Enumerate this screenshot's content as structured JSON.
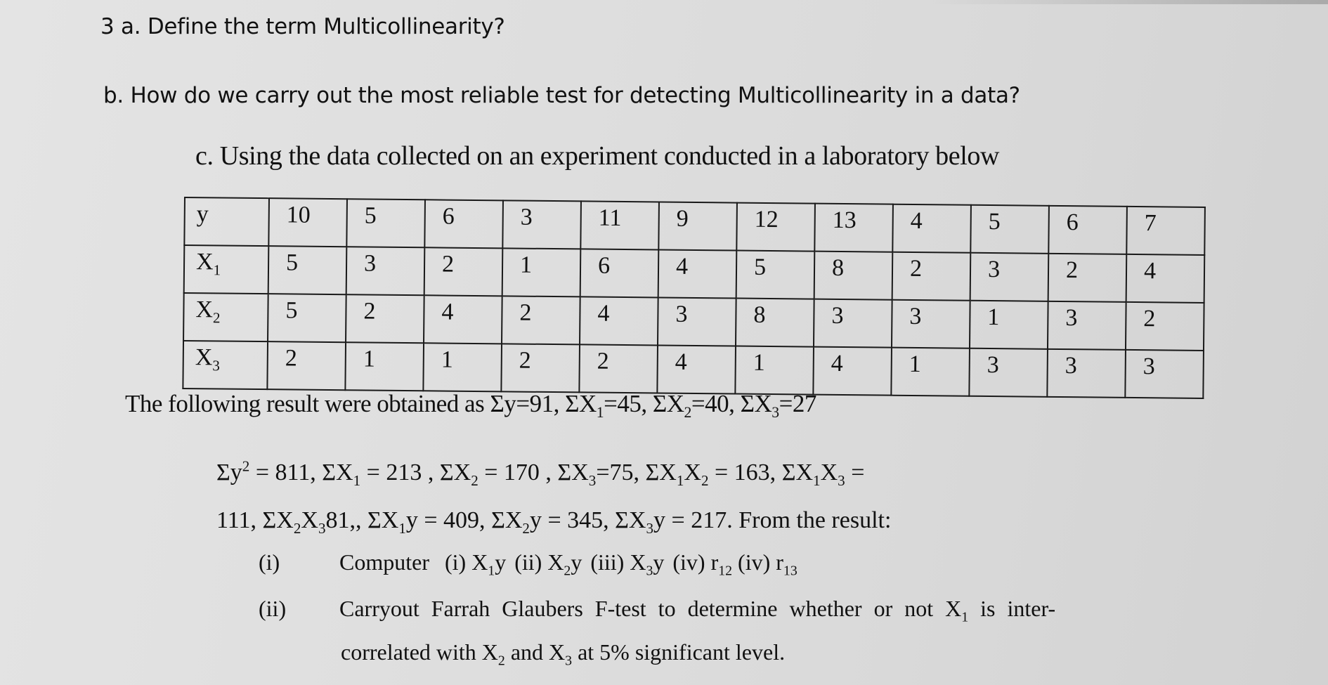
{
  "question_a": {
    "number": "3",
    "label": "a.",
    "text": "Define the term Multicollinearity?"
  },
  "question_b": {
    "label": "b.",
    "text": "How do we carry out the most reliable test for detecting Multicollinearity in a data?"
  },
  "question_c": {
    "label": "c.",
    "text": "Using the data collected on an experiment conducted in a laboratory below"
  },
  "table": {
    "rows": [
      {
        "var": "y",
        "sub": "",
        "values": [
          "10",
          "5",
          "6",
          "3",
          "11",
          "9",
          "12",
          "13",
          "4",
          "5",
          "6",
          "7"
        ]
      },
      {
        "var": "X",
        "sub": "1",
        "values": [
          "5",
          "3",
          "2",
          "1",
          "6",
          "4",
          "5",
          "8",
          "2",
          "3",
          "2",
          "4"
        ]
      },
      {
        "var": "X",
        "sub": "2",
        "values": [
          "5",
          "2",
          "4",
          "2",
          "4",
          "3",
          "8",
          "3",
          "3",
          "1",
          "3",
          "2"
        ]
      },
      {
        "var": "X",
        "sub": "3",
        "values": [
          "2",
          "1",
          "1",
          "2",
          "2",
          "4",
          "1",
          "4",
          "1",
          "3",
          "3",
          "3"
        ]
      }
    ]
  },
  "results": {
    "intro": "The following result were obtained as",
    "sum_y": "Σy=91,",
    "sum_x1_pre": "ΣX",
    "sum_x1_sub": "1",
    "sum_x1_post": "=45,",
    "sum_x2_pre": "ΣX",
    "sum_x2_sub": "2",
    "sum_x2_post": "=40,",
    "sum_x3_pre": "ΣX",
    "sum_x3_sub": "3",
    "sum_x3_post": "=27"
  },
  "equations": {
    "line1": {
      "sy2_pre": "Σy",
      "sy2_sup": "2",
      "sy2_post": " = 811, ",
      "sx1_pre": "ΣX",
      "sx1_sub": "1",
      "sx1_post": " = 213 , ",
      "sx2_pre": "ΣX",
      "sx2_sub": "2",
      "sx2_post": " = 170 , ",
      "sx3_pre": "ΣX",
      "sx3_sub": "3",
      "sx3_post": "=75, ",
      "sx1x2_pre": "ΣX",
      "sx1x2_sub1": "1",
      "sx1x2_mid": "X",
      "sx1x2_sub2": "2",
      "sx1x2_post": " = 163, ",
      "sx1x3_pre": "ΣX",
      "sx1x3_sub1": "1",
      "sx1x3_mid": "X",
      "sx1x3_sub2": "3",
      "sx1x3_post": " ="
    },
    "line2": {
      "v111": "111, ",
      "sx2x3_pre": "ΣX",
      "sx2x3_sub1": "2",
      "sx2x3_mid": "X",
      "sx2x3_sub2": "3",
      "sx2x3_post": "81,, ",
      "sx1y_pre": "ΣX",
      "sx1y_sub": "1",
      "sx1y_post": "y = 409, ",
      "sx2y_pre": "ΣX",
      "sx2y_sub": "2",
      "sx2y_post": "y = 345, ",
      "sx3y_pre": "ΣX",
      "sx3y_sub": "3",
      "sx3y_post": "y = 217.",
      "tail": " From the result:"
    }
  },
  "items": {
    "i": {
      "num": "(i)",
      "lead": "Computer",
      "p1_label": "(i) ",
      "p1_var": "X",
      "p1_sub": "1",
      "p1_post": "y",
      "p2_label": "(ii) ",
      "p2_var": "X",
      "p2_sub": "2",
      "p2_post": "y",
      "p3_label": "(iii) ",
      "p3_var": "X",
      "p3_sub": "3",
      "p3_post": "y",
      "p4_label": "(iv) ",
      "p4_var": "r",
      "p4_sub": "12",
      "p5_label": "(iv) ",
      "p5_var": "r",
      "p5_sub": "13"
    },
    "ii": {
      "num": "(ii)",
      "text_pre": "Carryout Farrah Glaubers F-test to determine whether or not ",
      "var": "X",
      "var_sub": "1",
      "text_post": " is inter-",
      "line2_pre": "correlated with ",
      "x2": "X",
      "x2_sub": "2",
      "and": " and ",
      "x3": "X",
      "x3_sub": "3",
      "line2_post": " at 5% significant level."
    }
  }
}
